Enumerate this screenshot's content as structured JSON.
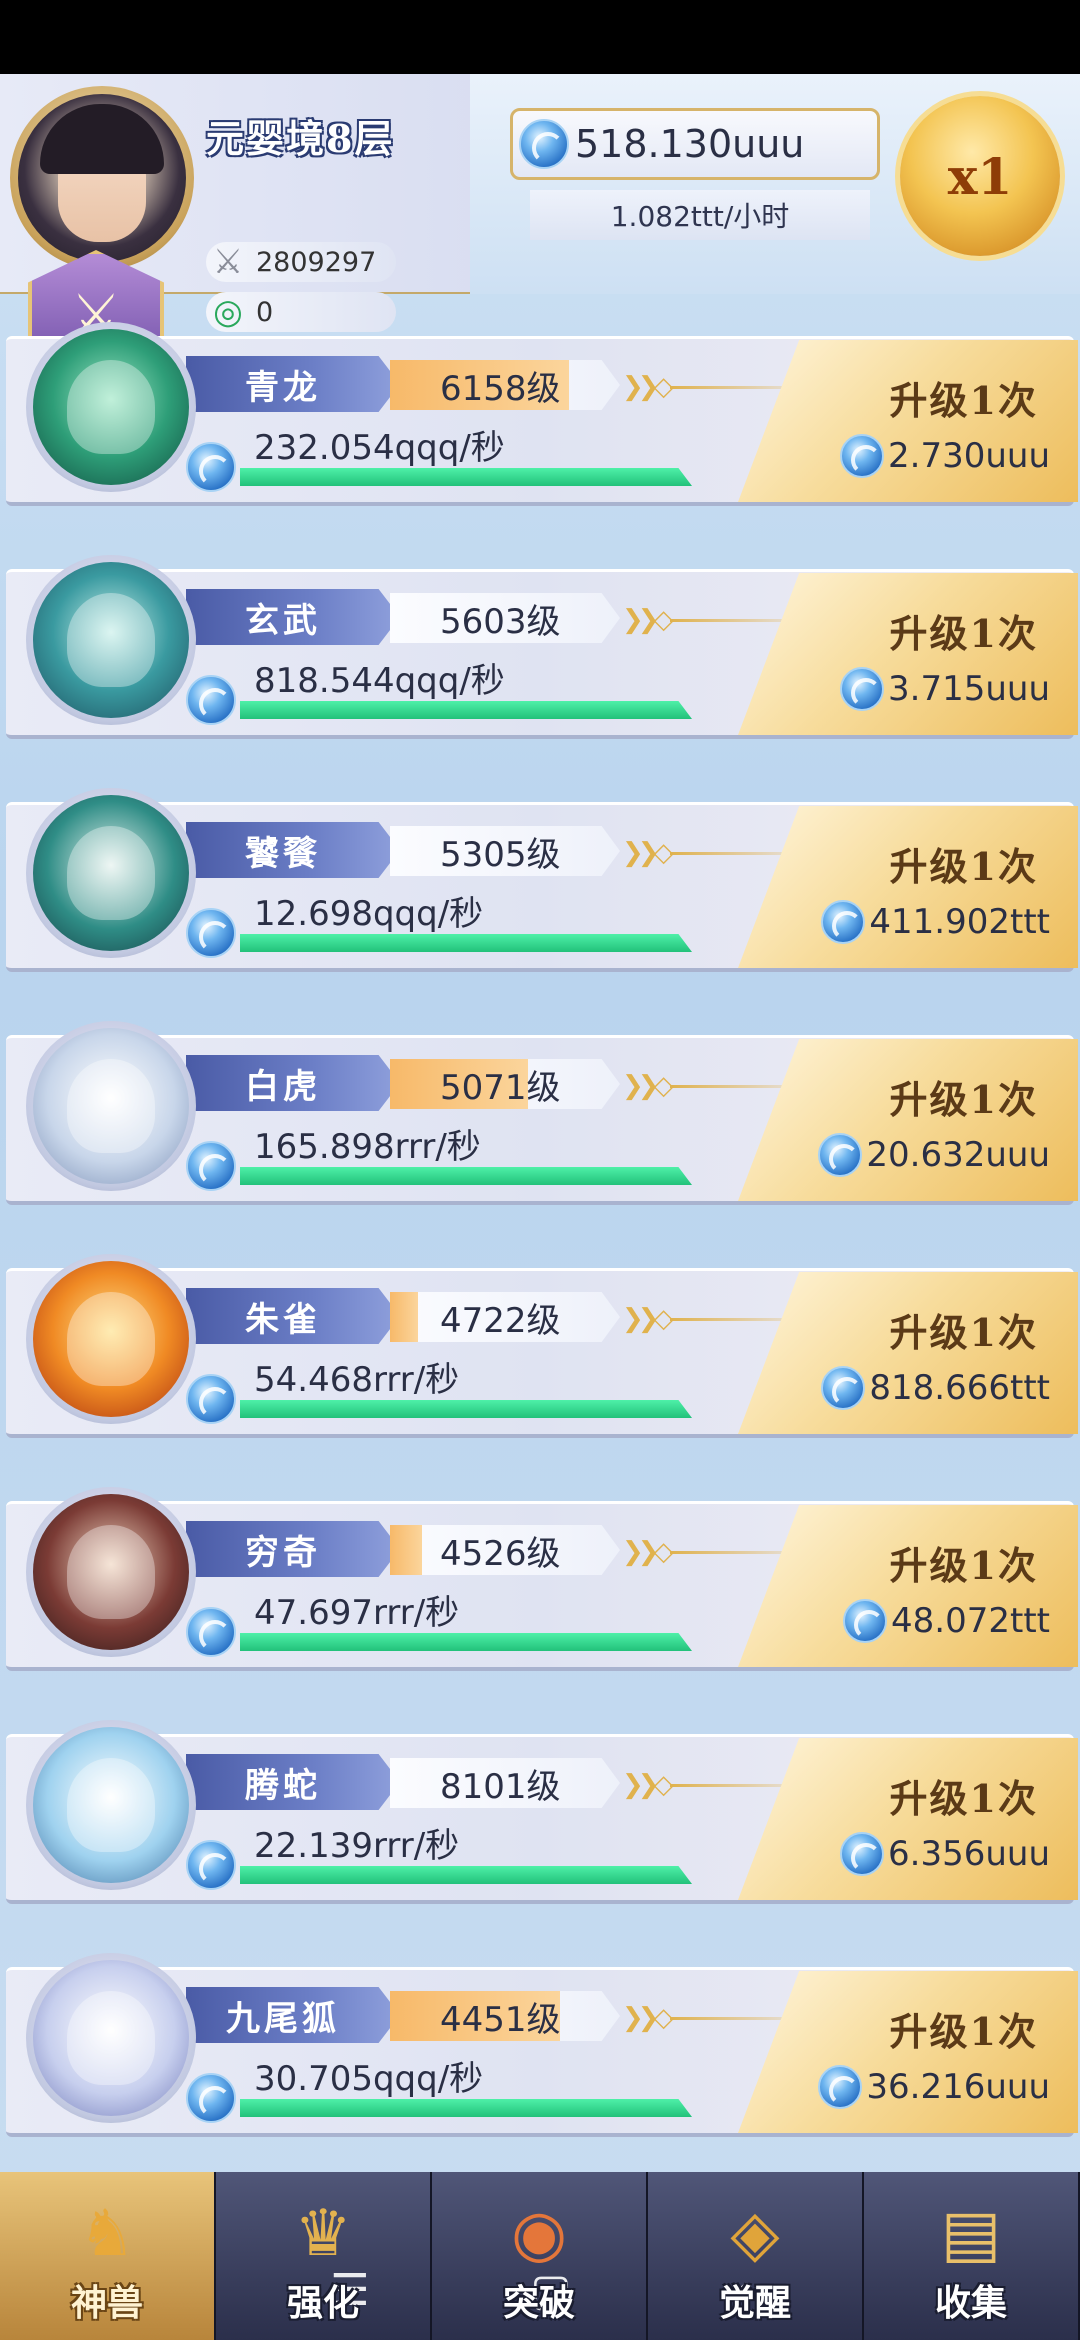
{
  "header": {
    "realm": "元婴境8层",
    "power": "2809297",
    "jade": "0",
    "currency": "518.130uuu",
    "rate": "1.082ttt/小时",
    "multiplier": "x1"
  },
  "beasts": [
    {
      "name": "青龙",
      "level": "6158级",
      "rate": "232.054qqq/秒",
      "upgrade_label": "升级1次",
      "cost": "2.730uuu"
    },
    {
      "name": "玄武",
      "level": "5603级",
      "rate": "818.544qqq/秒",
      "upgrade_label": "升级1次",
      "cost": "3.715uuu"
    },
    {
      "name": "饕餮",
      "level": "5305级",
      "rate": "12.698qqq/秒",
      "upgrade_label": "升级1次",
      "cost": "411.902ttt"
    },
    {
      "name": "白虎",
      "level": "5071级",
      "rate": "165.898rrr/秒",
      "upgrade_label": "升级1次",
      "cost": "20.632uuu"
    },
    {
      "name": "朱雀",
      "level": "4722级",
      "rate": "54.468rrr/秒",
      "upgrade_label": "升级1次",
      "cost": "818.666ttt"
    },
    {
      "name": "穷奇",
      "level": "4526级",
      "rate": "47.697rrr/秒",
      "upgrade_label": "升级1次",
      "cost": "48.072ttt"
    },
    {
      "name": "腾蛇",
      "level": "8101级",
      "rate": "22.139rrr/秒",
      "upgrade_label": "升级1次",
      "cost": "6.356uuu"
    },
    {
      "name": "九尾狐",
      "level": "4451级",
      "rate": "30.705qqq/秒",
      "upgrade_label": "升级1次",
      "cost": "36.216uuu"
    }
  ],
  "nav": [
    {
      "label": "神兽",
      "icon": "qilin-icon"
    },
    {
      "label": "强化",
      "icon": "helmet-icon"
    },
    {
      "label": "突破",
      "icon": "orb-icon"
    },
    {
      "label": "觉醒",
      "icon": "eye-icon"
    },
    {
      "label": "收集",
      "icon": "scroll-icon"
    }
  ],
  "system_nav": {
    "menu": "☰",
    "home": "▢",
    "back": "‹"
  }
}
